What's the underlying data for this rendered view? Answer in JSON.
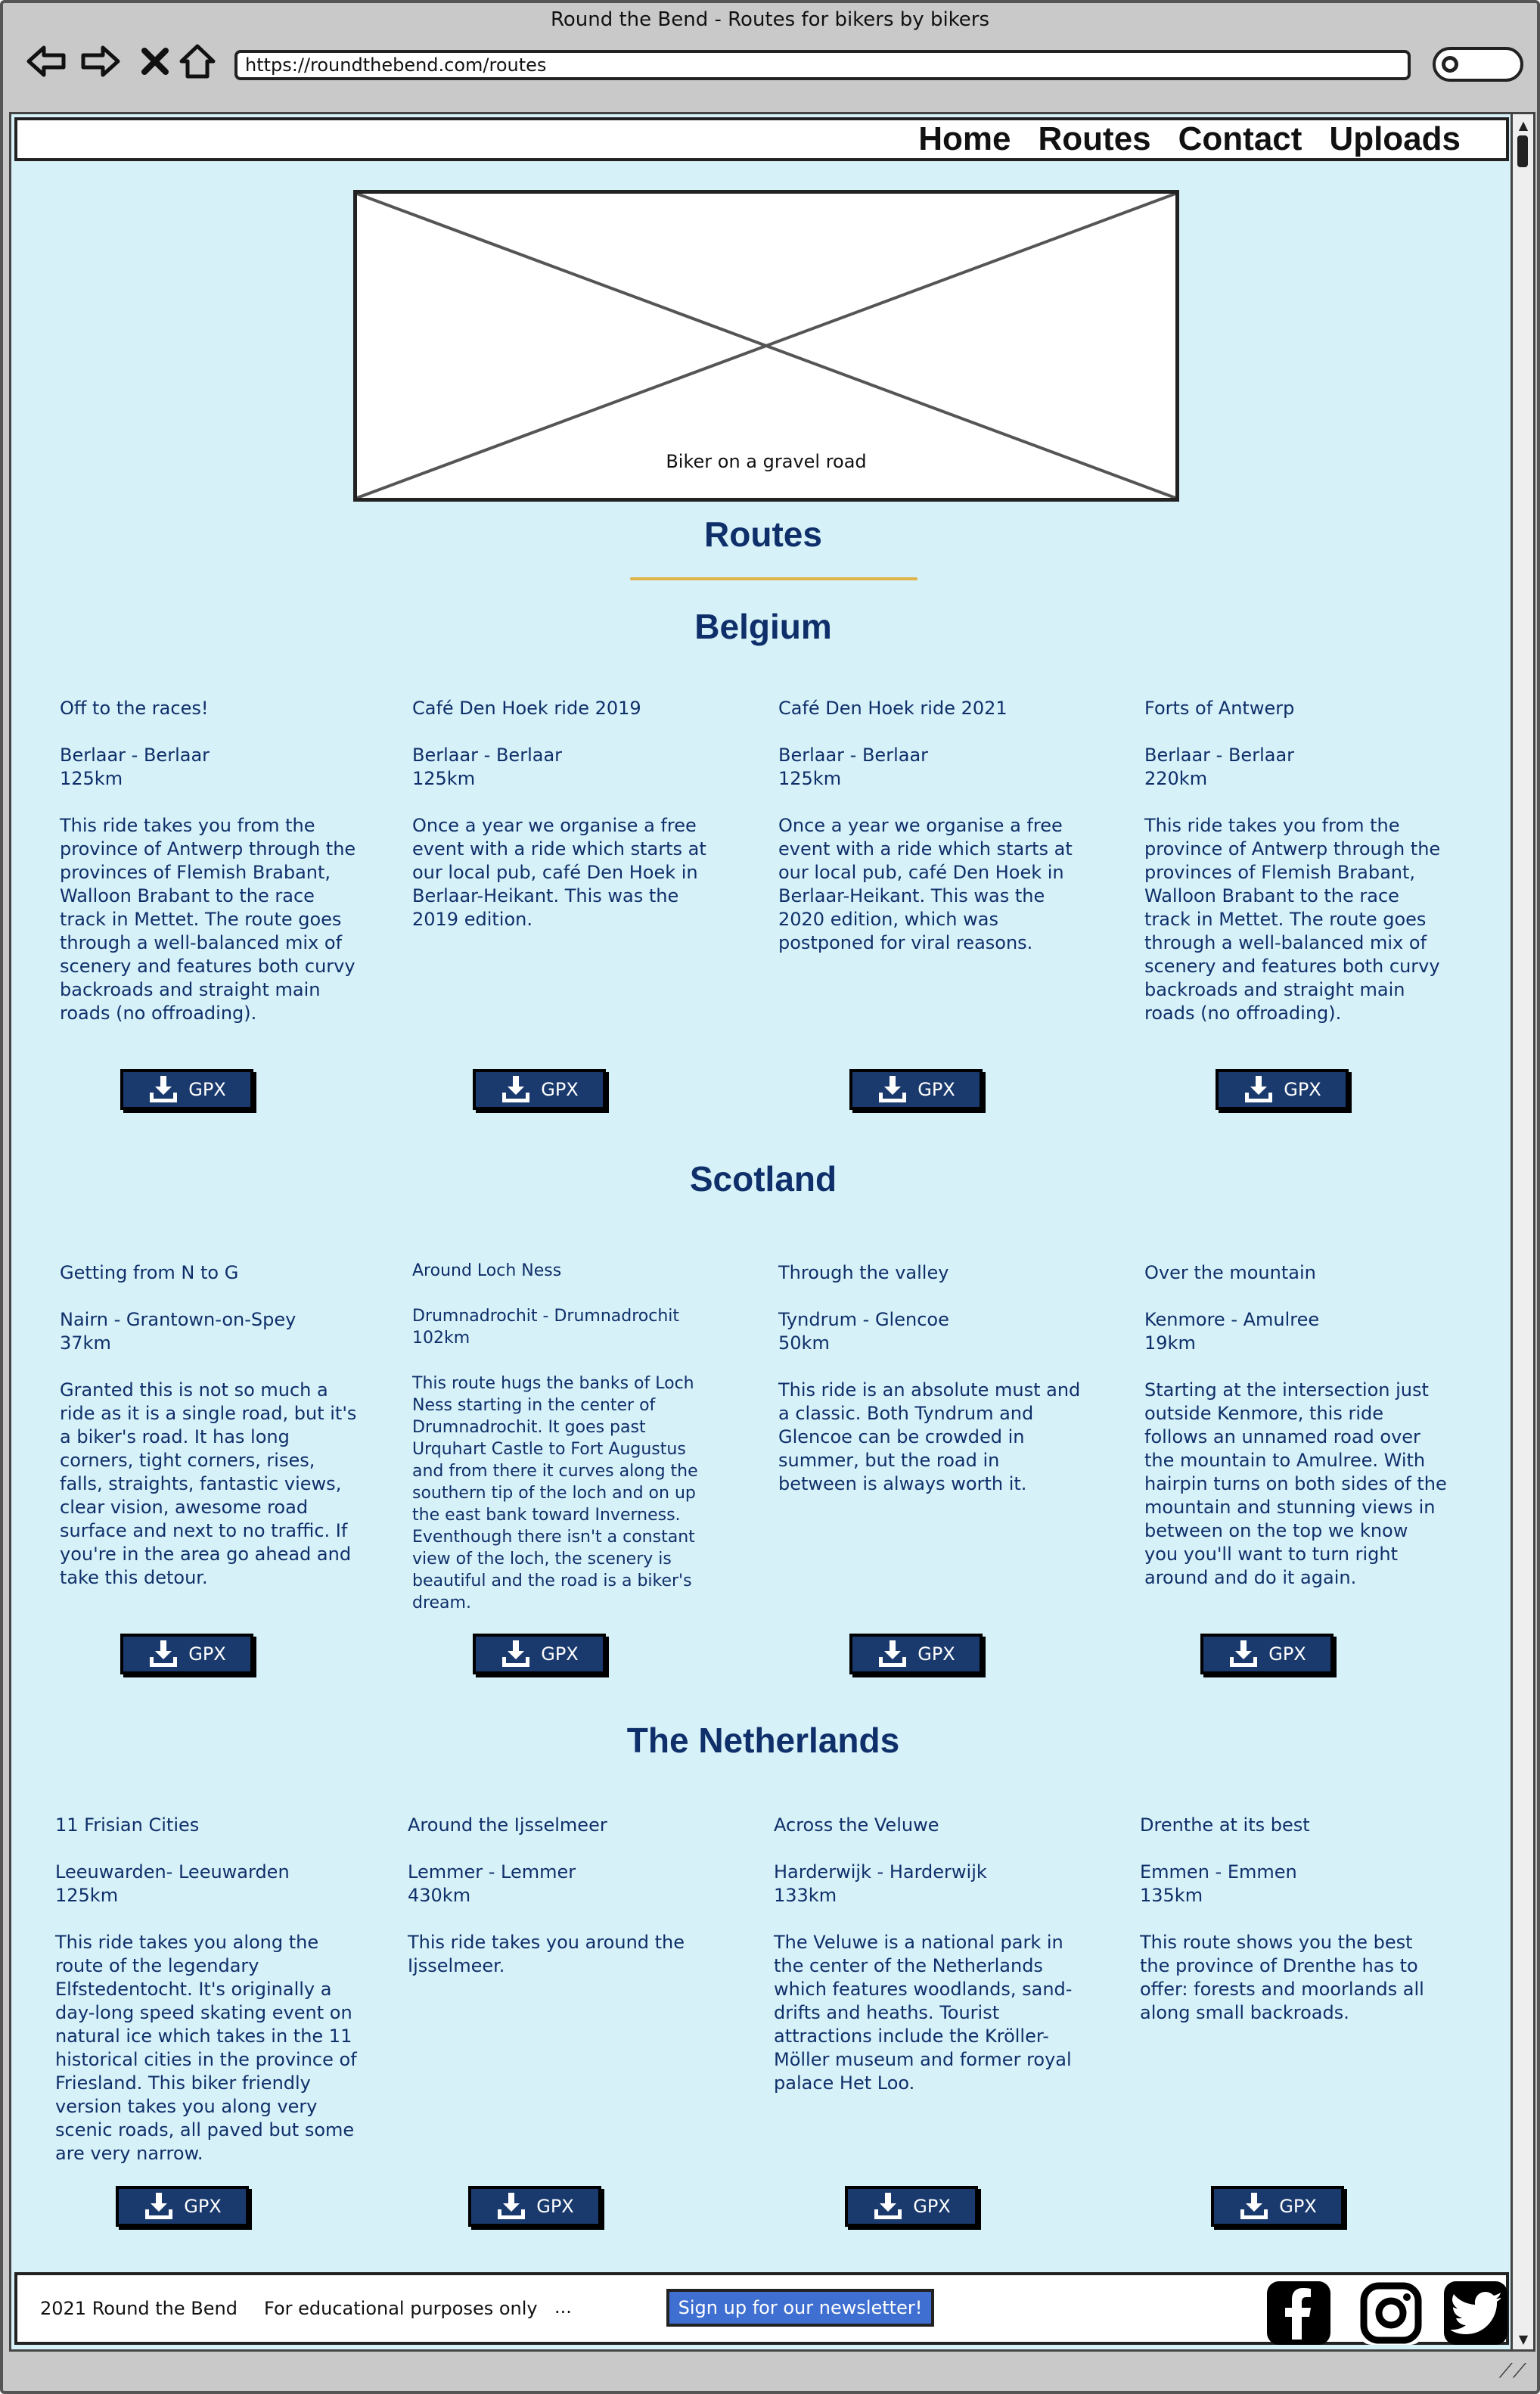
{
  "browser": {
    "window_title": "Round the Bend - Routes for bikers by bikers",
    "url": "https://roundthebend.com/routes"
  },
  "nav": {
    "items": [
      "Home",
      "Routes",
      "Contact",
      "Uploads"
    ]
  },
  "hero": {
    "caption": "Biker on a gravel road"
  },
  "page_title": "Routes",
  "gpx_label": "GPX",
  "countries": [
    {
      "name": "Belgium",
      "routes": [
        {
          "title": "Off to the races!",
          "route": "Berlaar - Berlaar",
          "distance": "125km",
          "description": "This ride takes you from the province of Antwerp through the provinces of Flemish Brabant, Walloon Brabant to the race track in Mettet. The route goes through a well-balanced mix of scenery and features both curvy backroads and straight main roads (no offroading)."
        },
        {
          "title": "Café Den Hoek ride 2019",
          "route": "Berlaar - Berlaar",
          "distance": "125km",
          "description": "Once a year we organise a free event with a ride which starts at our local pub, café Den Hoek in Berlaar-Heikant. This was the 2019 edition."
        },
        {
          "title": "Café Den Hoek ride 2021",
          "route": "Berlaar - Berlaar",
          "distance": "125km",
          "description": "Once a year we organise a free event with a ride which starts at our local pub, café Den Hoek in Berlaar-Heikant. This was the 2020 edition, which was postponed for viral reasons."
        },
        {
          "title": "Forts of Antwerp",
          "route": "Berlaar - Berlaar",
          "distance": "220km",
          "description": "This ride takes you from the province of Antwerp through the provinces of Flemish Brabant, Walloon Brabant to the race track in Mettet. The route goes through a well-balanced mix of scenery and features both curvy backroads and straight main roads (no offroading)."
        }
      ]
    },
    {
      "name": "Scotland",
      "routes": [
        {
          "title": "Getting from N to G",
          "route": "Nairn - Grantown-on-Spey",
          "distance": "37km",
          "description": "Granted this is not so much a ride as it is a single road, but it's a biker's road. It has long corners, tight corners, rises, falls, straights, fantastic views, clear vision, awesome road surface and next to no traffic. If you're in the area go ahead and take this detour."
        },
        {
          "title": "Around Loch Ness",
          "route": "Drumnadrochit - Drumnadrochit",
          "distance": "102km",
          "description": "This route hugs the banks of Loch Ness starting in the center of Drumnadrochit. It goes past Urquhart Castle to Fort Augustus and from there it curves along the southern tip of the loch and on up the east bank toward Inverness. Eventhough there isn't a constant view of the loch, the scenery is beautiful and the road is a biker's dream."
        },
        {
          "title": "Through the valley",
          "route": "Tyndrum - Glencoe",
          "distance": "50km",
          "description": "This ride is an absolute must and a classic. Both Tyndrum and Glencoe can be crowded in summer, but the road in between is always worth it."
        },
        {
          "title": "Over the mountain",
          "route": "Kenmore - Amulree",
          "distance": "19km",
          "description": "Starting at the intersection just outside Kenmore, this ride follows an unnamed road over the mountain to Amulree. With hairpin turns on both sides of the mountain and stunning views in between on the top we know you you'll want to turn right around and do it again."
        }
      ]
    },
    {
      "name": "The Netherlands",
      "routes": [
        {
          "title": "11 Frisian Cities",
          "route": "Leeuwarden- Leeuwarden",
          "distance": "125km",
          "description": "This ride takes you along the route of the legendary Elfstedentocht. It's originally a day-long speed skating event on natural ice which takes in the 11 historical cities in the province of Friesland. This biker friendly version takes you along very scenic roads, all paved but some are very narrow."
        },
        {
          "title": "Around the Ijsselmeer",
          "route": "Lemmer - Lemmer",
          "distance": "430km",
          "description": "This ride takes you around the Ijsselmeer."
        },
        {
          "title": "Across the Veluwe",
          "route": "Harderwijk - Harderwijk",
          "distance": "133km",
          "description": "The Veluwe is a national park in the center of the Netherlands which features woodlands, sand-drifts and heaths. Tourist attractions include the Kröller-Möller museum and former royal palace Het Loo."
        },
        {
          "title": "Drenthe at its best",
          "route": "Emmen - Emmen",
          "distance": "135km",
          "description": "This route shows you the best the province of Drenthe has to offer: forests and moorlands all along small backroads."
        }
      ]
    }
  ],
  "footer": {
    "copyright": "2021 Round the Bend",
    "note": "For educational purposes only",
    "ellipsis": "...",
    "newsletter": "Sign up for our newsletter!"
  },
  "colors": {
    "background": "#d6f1f7",
    "heading": "#0f2f6a",
    "button": "#1a3a6e",
    "accent_underline": "#e0b24a",
    "newsletter_button": "#3f6fd0"
  },
  "icons": [
    "back-icon",
    "forward-icon",
    "close-icon",
    "home-icon",
    "search-icon",
    "download-icon",
    "facebook-icon",
    "instagram-icon",
    "twitter-icon"
  ]
}
